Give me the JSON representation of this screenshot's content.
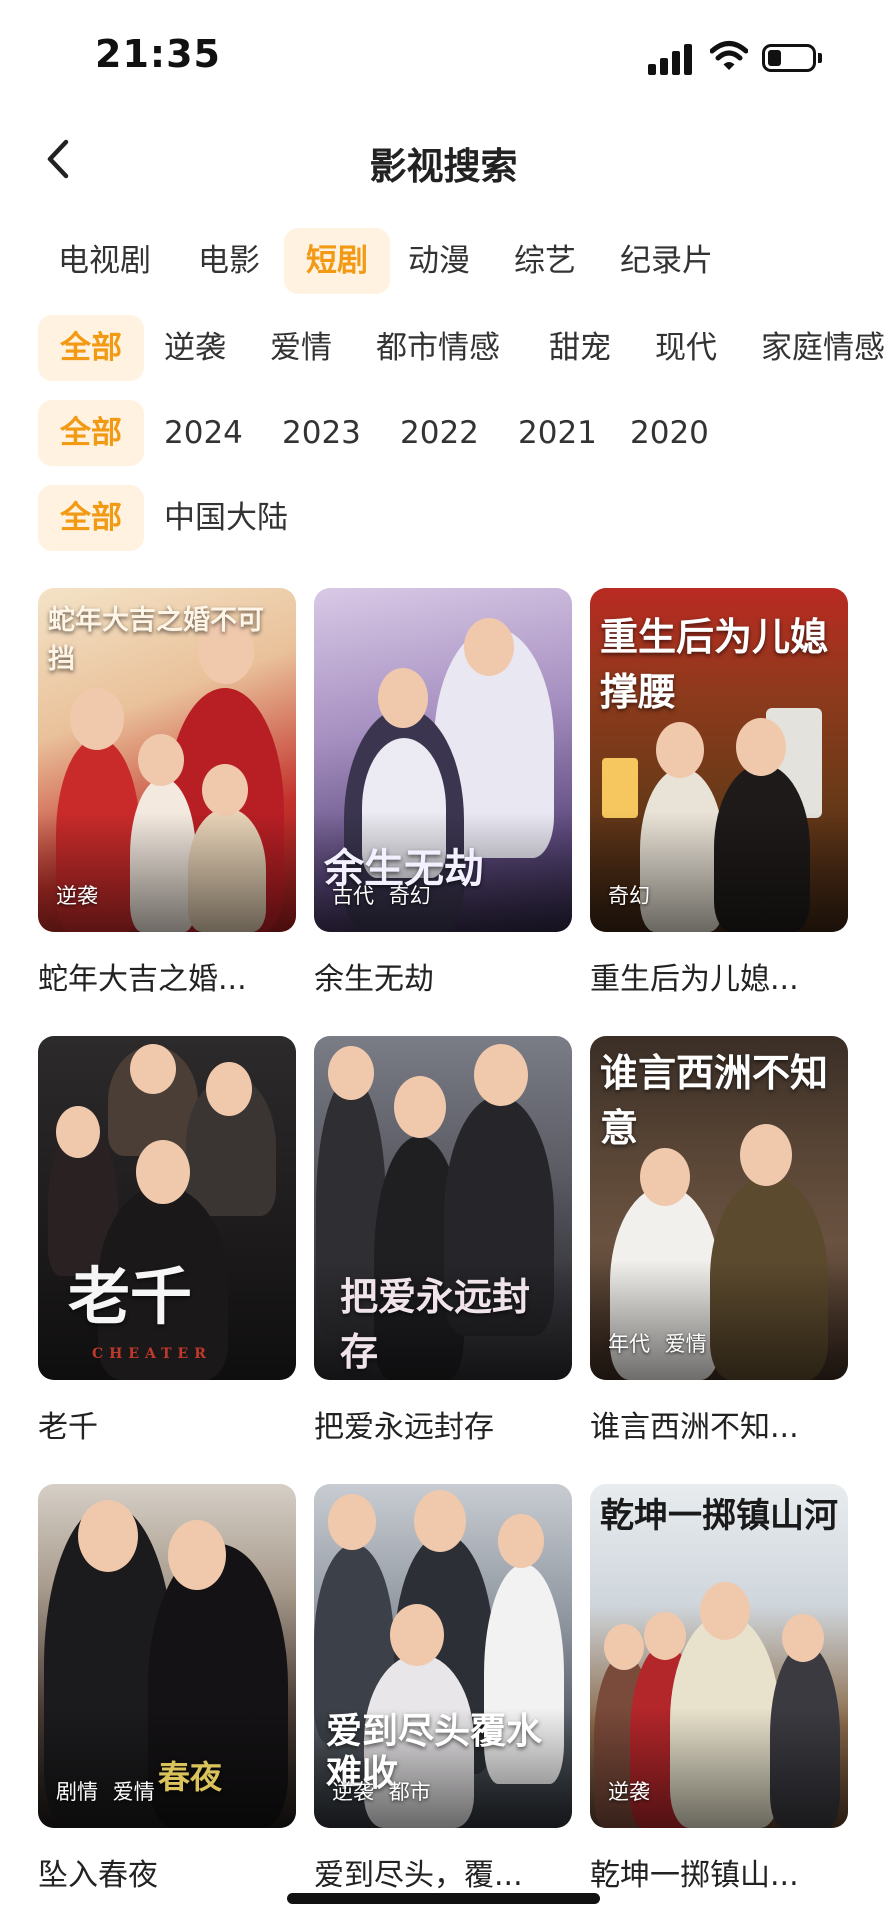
{
  "status_bar": {
    "time": "21:35",
    "battery_level": 0.3
  },
  "header": {
    "title": "影视搜索",
    "back_icon": "chevron-left-icon"
  },
  "category_tabs": [
    "电视剧",
    "电影",
    "短剧",
    "动漫",
    "综艺",
    "纪录片"
  ],
  "active_category": "短剧",
  "genre_filters": [
    "全部",
    "逆袭",
    "爱情",
    "都市情感",
    "甜宠",
    "现代",
    "家庭情感"
  ],
  "year_filters": [
    "全部",
    "2024",
    "2023",
    "2022",
    "2021",
    "2020"
  ],
  "region_filters": [
    "全部",
    "中国大陆"
  ],
  "accent_color": "#f29a13",
  "accent_bg": "#fff2e0",
  "items": [
    {
      "title": "蛇年大吉之婚...",
      "poster_text": "蛇年大吉之婚不可挡",
      "tags": [
        "逆袭"
      ]
    },
    {
      "title": "余生无劫",
      "poster_text": "余生无劫",
      "tags": [
        "古代",
        "奇幻"
      ]
    },
    {
      "title": "重生后为儿媳...",
      "poster_text": "重生后为儿媳撑腰",
      "tags": [
        "奇幻"
      ]
    },
    {
      "title": "老千",
      "poster_text": "老千",
      "poster_subtext": "CHEATER",
      "tags": []
    },
    {
      "title": "把爱永远封存",
      "poster_text": "把爱永远封存",
      "tags": []
    },
    {
      "title": "谁言西洲不知...",
      "poster_text": "谁言西洲不知意",
      "tags": [
        "年代",
        "爱情"
      ]
    },
    {
      "title": "坠入春夜",
      "poster_text": "春夜",
      "tags": [
        "剧情",
        "爱情"
      ]
    },
    {
      "title": "爱到尽头，覆...",
      "poster_text": "爱到尽头覆水难收",
      "tags": [
        "逆袭",
        "都市"
      ]
    },
    {
      "title": "乾坤一掷镇山...",
      "poster_text": "乾坤一掷镇山河",
      "tags": [
        "逆袭"
      ]
    }
  ]
}
